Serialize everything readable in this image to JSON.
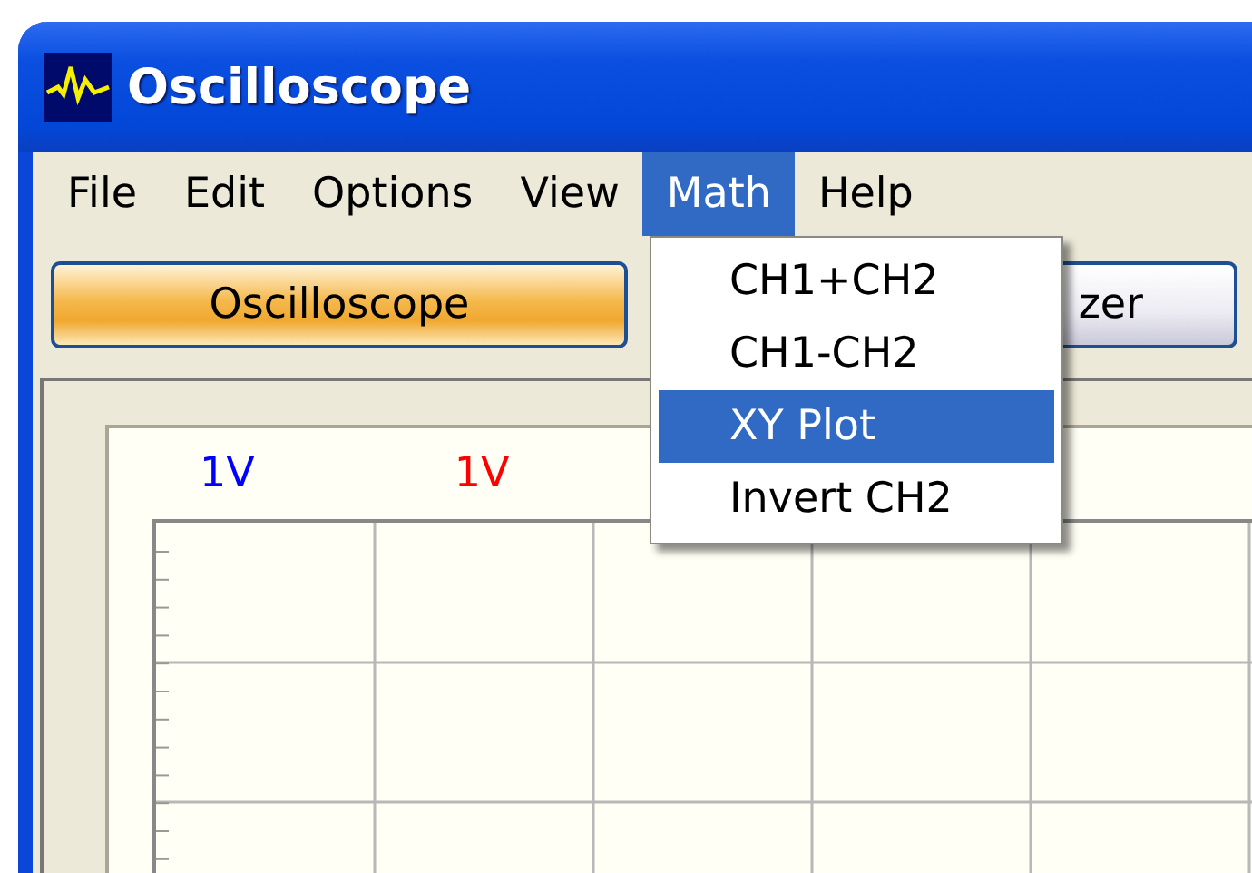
{
  "window": {
    "title": "Oscilloscope"
  },
  "menu_bar": [
    {
      "label": "File",
      "selected": false
    },
    {
      "label": "Edit",
      "selected": false
    },
    {
      "label": "Options",
      "selected": false
    },
    {
      "label": "View",
      "selected": false
    },
    {
      "label": "Math",
      "selected": true
    },
    {
      "label": "Help",
      "selected": false
    }
  ],
  "math_menu": [
    {
      "label": "CH1+CH2",
      "selected": false
    },
    {
      "label": "CH1-CH2",
      "selected": false
    },
    {
      "label": "XY Plot",
      "selected": true
    },
    {
      "label": "Invert CH2",
      "selected": false
    }
  ],
  "mode_buttons": [
    {
      "label": "Oscilloscope",
      "selected": true
    },
    {
      "label": "zer",
      "selected": false
    }
  ],
  "channel_scales": [
    {
      "label": "1V",
      "color": "#0000ff"
    },
    {
      "label": "1V",
      "color": "#ff0000"
    }
  ]
}
